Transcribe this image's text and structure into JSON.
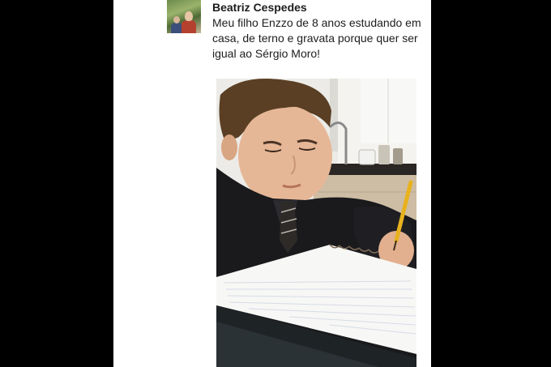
{
  "post": {
    "author": "Beatriz Cespedes",
    "caption": "Meu filho Enzzo de 8 anos estudando em casa, de terno e gravata porque quer ser igual ao Sérgio Moro!"
  },
  "colors": {
    "background": "#000000",
    "card": "#ffffff",
    "text": "#1d1d1d"
  }
}
